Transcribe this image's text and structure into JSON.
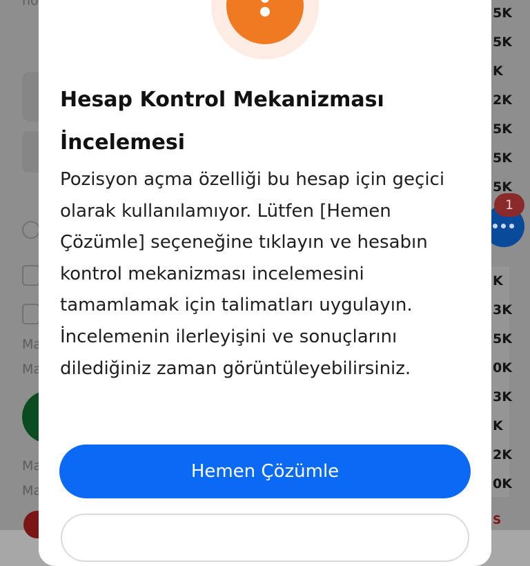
{
  "background": {
    "right_column_items": [
      "5K",
      "5K",
      "K",
      "2K",
      "5K",
      "5K",
      "5K",
      "K",
      "3K",
      "5K",
      "0K",
      "3K",
      "K",
      "2K",
      "0K",
      "S"
    ],
    "left_texts": [
      "Ma",
      "Ma",
      "Ma",
      "Ma"
    ],
    "chat_badge_count": "1"
  },
  "dialog": {
    "icon": "exclamation-icon",
    "title": "Hesap Kontrol Mekanizması İncelemesi",
    "message": "Pozisyon açma özelliği bu hesap için geçici olarak kullanılamıyor. Lütfen [Hemen Çözümle] seçeneğine tıklayın ve hesabın kontrol mekanizması incelemesini tamamlamak için talimatları uygulayın. İncelemenin ilerleyişini ve sonuçlarını dilediğiniz zaman görüntüleyebilirsiniz.",
    "primary_button_label": "Hemen Çözümle",
    "primary_button_color": "#0a69f5",
    "accent_color": "#ef7a22"
  }
}
